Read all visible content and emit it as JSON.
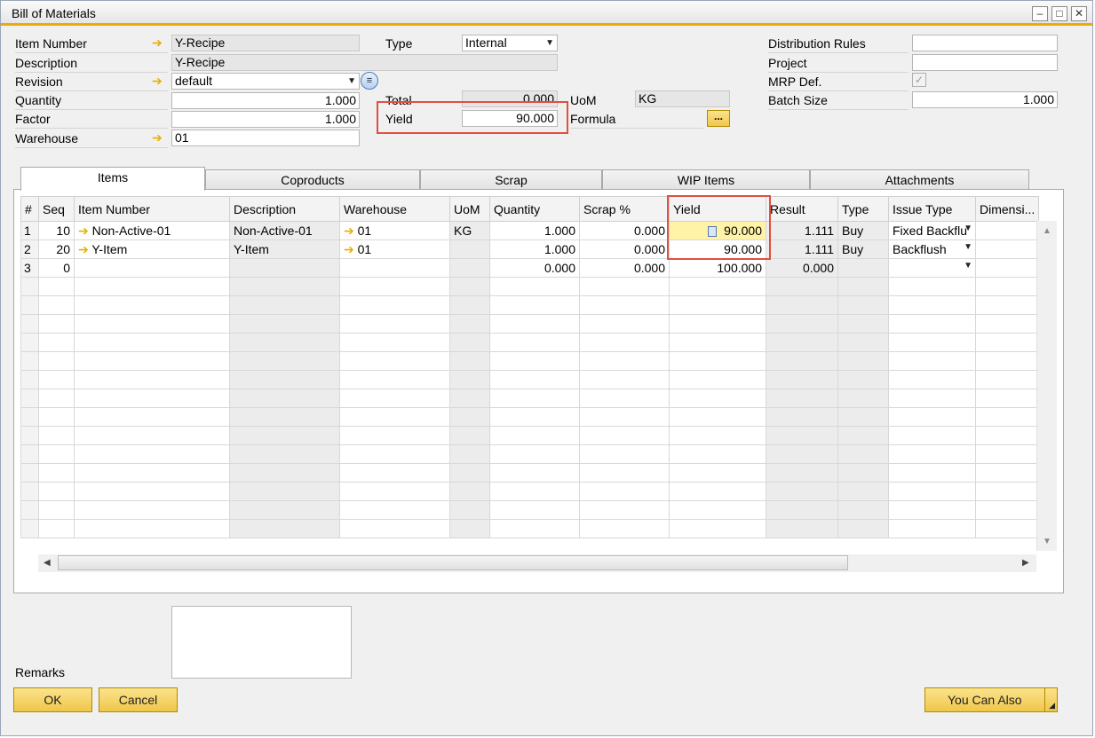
{
  "window": {
    "title": "Bill of Materials"
  },
  "header": {
    "item_number_label": "Item Number",
    "item_number": "Y-Recipe",
    "description_label": "Description",
    "description": "Y-Recipe",
    "revision_label": "Revision",
    "revision": "default",
    "quantity_label": "Quantity",
    "quantity": "1.000",
    "factor_label": "Factor",
    "factor": "1.000",
    "warehouse_label": "Warehouse",
    "warehouse": "01",
    "type_label": "Type",
    "type": "Internal",
    "total_label": "Total",
    "total": "0.000",
    "yield_label": "Yield",
    "yield": "90.000",
    "uom_label": "UoM",
    "uom": "KG",
    "formula_label": "Formula",
    "formula_button": "...",
    "distribution_rules_label": "Distribution Rules",
    "distribution_rules": "",
    "project_label": "Project",
    "project": "",
    "mrp_def_label": "MRP Def.",
    "batch_size_label": "Batch Size",
    "batch_size": "1.000"
  },
  "tabs": [
    "Items",
    "Coproducts",
    "Scrap",
    "WIP Items",
    "Attachments"
  ],
  "grid": {
    "columns": [
      "#",
      "Seq",
      "Item Number",
      "Description",
      "Warehouse",
      "UoM",
      "Quantity",
      "Scrap %",
      "Yield",
      "Result",
      "Type",
      "Issue Type",
      "Dimensi..."
    ],
    "rows": [
      {
        "num": "1",
        "seq": "10",
        "item": "Non-Active-01",
        "desc": "Non-Active-01",
        "wh": "01",
        "uom": "KG",
        "qty": "1.000",
        "scrap": "0.000",
        "yield": "90.000",
        "result": "1.111",
        "type": "Buy",
        "issue": "Fixed Backflu"
      },
      {
        "num": "2",
        "seq": "20",
        "item": "Y-Item",
        "desc": "Y-Item",
        "wh": "01",
        "uom": "",
        "qty": "1.000",
        "scrap": "0.000",
        "yield": "90.000",
        "result": "1.111",
        "type": "Buy",
        "issue": "Backflush"
      },
      {
        "num": "3",
        "seq": "0",
        "item": "",
        "desc": "",
        "wh": "",
        "uom": "",
        "qty": "0.000",
        "scrap": "0.000",
        "yield": "100.000",
        "result": "0.000",
        "type": "",
        "issue": ""
      }
    ]
  },
  "footer": {
    "remarks_label": "Remarks",
    "ok_label": "OK",
    "cancel_label": "Cancel",
    "you_can_also_label": "You Can Also"
  }
}
